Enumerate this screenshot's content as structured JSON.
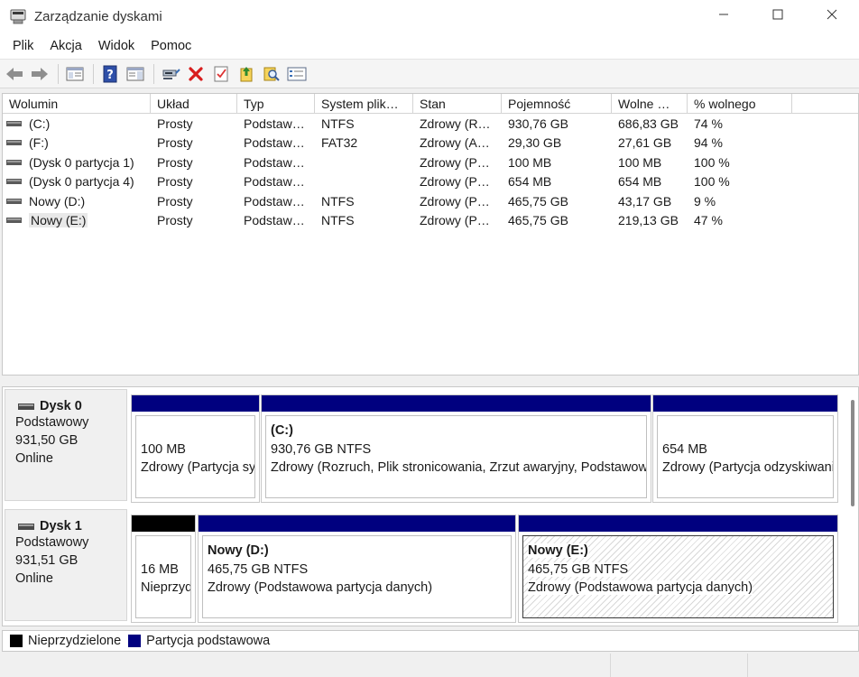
{
  "window": {
    "title": "Zarządzanie dyskami",
    "controls": {
      "minimize": "—",
      "maximize": "☐",
      "close": "✕"
    }
  },
  "menu": [
    {
      "label": "Plik"
    },
    {
      "label": "Akcja"
    },
    {
      "label": "Widok"
    },
    {
      "label": "Pomoc"
    }
  ],
  "toolbar": [
    {
      "icon": "back-arrow-icon"
    },
    {
      "icon": "forward-arrow-icon"
    },
    {
      "icon": "console-tree-icon"
    },
    {
      "icon": "help-icon"
    },
    {
      "icon": "show-hide-panel-icon"
    },
    {
      "icon": "connect-drive-icon"
    },
    {
      "icon": "delete-icon"
    },
    {
      "icon": "properties-checklist-icon"
    },
    {
      "icon": "export-up-icon"
    },
    {
      "icon": "search-folder-icon"
    },
    {
      "icon": "view-list-icon"
    }
  ],
  "volumes": {
    "columns": [
      "Wolumin",
      "Układ",
      "Typ",
      "System plik…",
      "Stan",
      "Pojemność",
      "Wolne …",
      "% wolnego"
    ],
    "rows": [
      {
        "name": "(C:)",
        "layout": "Prosty",
        "type": "Podstaw…",
        "fs": "NTFS",
        "status": "Zdrowy (R…",
        "capacity": "930,76 GB",
        "free": "686,83 GB",
        "pct": "74 %"
      },
      {
        "name": "(F:)",
        "layout": "Prosty",
        "type": "Podstaw…",
        "fs": "FAT32",
        "status": "Zdrowy (A…",
        "capacity": "29,30 GB",
        "free": "27,61 GB",
        "pct": "94 %"
      },
      {
        "name": "(Dysk 0 partycja 1)",
        "layout": "Prosty",
        "type": "Podstaw…",
        "fs": "",
        "status": "Zdrowy (P…",
        "capacity": "100 MB",
        "free": "100 MB",
        "pct": "100 %"
      },
      {
        "name": "(Dysk 0 partycja 4)",
        "layout": "Prosty",
        "type": "Podstaw…",
        "fs": "",
        "status": "Zdrowy (P…",
        "capacity": "654 MB",
        "free": "654 MB",
        "pct": "100 %"
      },
      {
        "name": "Nowy (D:)",
        "layout": "Prosty",
        "type": "Podstaw…",
        "fs": "NTFS",
        "status": "Zdrowy (P…",
        "capacity": "465,75 GB",
        "free": "43,17 GB",
        "pct": "9 %"
      },
      {
        "name": "Nowy (E:)",
        "layout": "Prosty",
        "type": "Podstaw…",
        "fs": "NTFS",
        "status": "Zdrowy (P…",
        "capacity": "465,75 GB",
        "free": "219,13 GB",
        "pct": "47 %"
      }
    ]
  },
  "disks": [
    {
      "name": "Dysk 0",
      "type": "Podstawowy",
      "size": "931,50 GB",
      "state": "Online",
      "partitions": [
        {
          "bar": "blue",
          "title": "",
          "size": "100 MB",
          "status": "Zdrowy (Partycja systemowa EFI)"
        },
        {
          "bar": "blue",
          "title": "(C:)",
          "size": "930,76 GB NTFS",
          "status": "Zdrowy (Rozruch, Plik stronicowania, Zrzut awaryjny, Podstawowa partycja danych)"
        },
        {
          "bar": "blue",
          "title": "",
          "size": "654 MB",
          "status": "Zdrowy (Partycja odzyskiwania)"
        }
      ]
    },
    {
      "name": "Dysk 1",
      "type": "Podstawowy",
      "size": "931,51 GB",
      "state": "Online",
      "partitions": [
        {
          "bar": "black",
          "title": "",
          "size": "16 MB",
          "status": "Nieprzydzielone"
        },
        {
          "bar": "blue",
          "title": "Nowy  (D:)",
          "size": "465,75 GB NTFS",
          "status": "Zdrowy (Podstawowa partycja danych)"
        },
        {
          "bar": "blue",
          "title": "Nowy  (E:)",
          "size": "465,75 GB NTFS",
          "status": "Zdrowy (Podstawowa partycja danych)",
          "selected": true
        }
      ]
    }
  ],
  "legend": [
    {
      "label": "Nieprzydzielone",
      "color": "#000000"
    },
    {
      "label": "Partycja podstawowa",
      "color": "#00007f"
    }
  ],
  "colors": {
    "primary_partition": "#00007f",
    "unallocated": "#000000"
  }
}
